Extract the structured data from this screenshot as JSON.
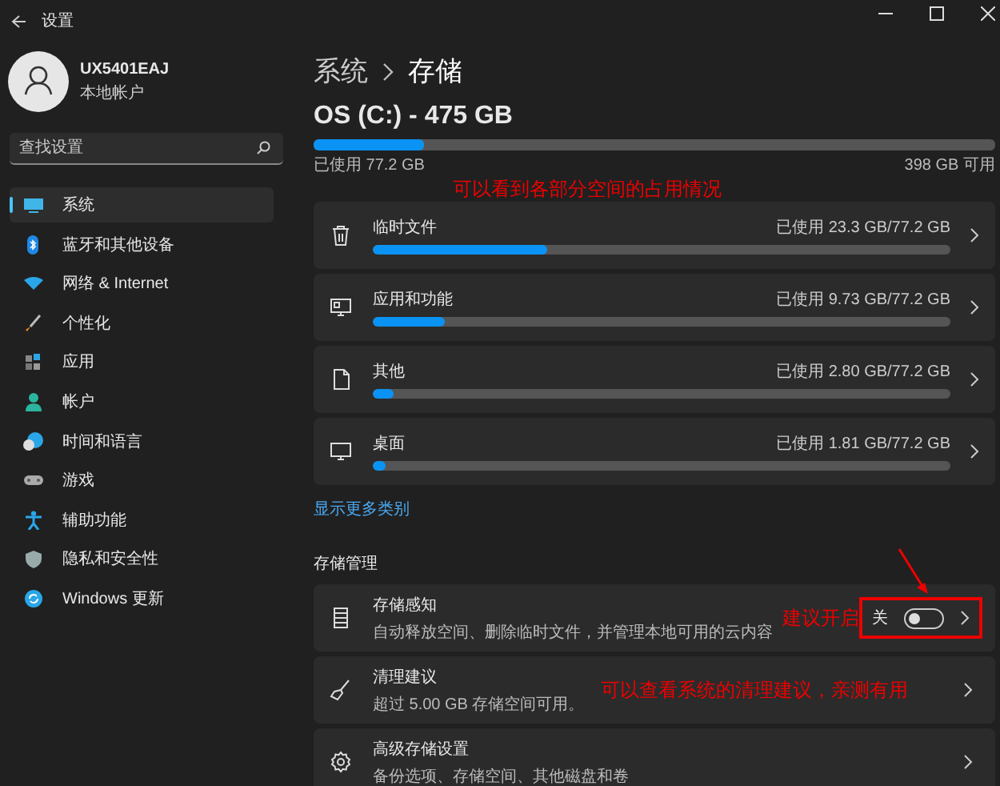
{
  "window": {
    "title": "设置"
  },
  "account": {
    "name": "UX5401EAJ",
    "type": "本地帐户"
  },
  "search": {
    "placeholder": "查找设置"
  },
  "nav": [
    {
      "label": "系统",
      "selected": true
    },
    {
      "label": "蓝牙和其他设备",
      "selected": false
    },
    {
      "label": "网络 & Internet",
      "selected": false
    },
    {
      "label": "个性化",
      "selected": false
    },
    {
      "label": "应用",
      "selected": false
    },
    {
      "label": "帐户",
      "selected": false
    },
    {
      "label": "时间和语言",
      "selected": false
    },
    {
      "label": "游戏",
      "selected": false
    },
    {
      "label": "辅助功能",
      "selected": false
    },
    {
      "label": "隐私和安全性",
      "selected": false
    },
    {
      "label": "Windows 更新",
      "selected": false
    }
  ],
  "breadcrumb": {
    "parent": "系统",
    "current": "存储"
  },
  "drive": {
    "title": "OS (C:) - 475 GB",
    "level": 0.163,
    "used": "已使用 77.2 GB",
    "free": "398 GB 可用",
    "annotation": "可以看到各部分空间的占用情况"
  },
  "categories": [
    {
      "name": "临时文件",
      "usage": "已使用 23.3 GB/77.2 GB",
      "level": 0.302
    },
    {
      "name": "应用和功能",
      "usage": "已使用 9.73 GB/77.2 GB",
      "level": 0.126
    },
    {
      "name": "其他",
      "usage": "已使用 2.80 GB/77.2 GB",
      "level": 0.036
    },
    {
      "name": "桌面",
      "usage": "已使用 1.81 GB/77.2 GB",
      "level": 0.023
    }
  ],
  "more_link": "显示更多类别",
  "management": {
    "heading": "存储管理",
    "items": [
      {
        "kind": "toggle",
        "title": "存储感知",
        "subtitle": "自动释放空间、删除临时文件，并管理本地可用的云内容",
        "state_label": "关",
        "on": false,
        "annotation": "建议开启",
        "highlighted": true
      },
      {
        "kind": "link",
        "title": "清理建议",
        "subtitle": "超过 5.00 GB 存储空间可用。",
        "annotation": "可以查看系统的清理建议，亲测有用",
        "highlighted": false
      },
      {
        "kind": "link",
        "title": "高级存储设置",
        "subtitle": "备份选项、存储空间、其他磁盘和卷",
        "highlighted": false
      }
    ]
  }
}
